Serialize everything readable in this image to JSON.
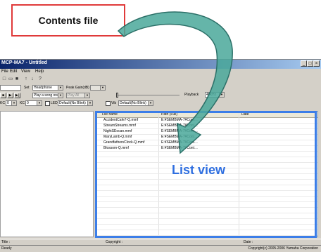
{
  "callout": {
    "text": "Contents file"
  },
  "list_view_label": "List view",
  "window": {
    "title": "MCP-MA7 - Untitled",
    "controls": [
      "_",
      "□",
      "×"
    ]
  },
  "menu": [
    "File",
    "Edit",
    "View",
    "Help"
  ],
  "toolbar": [
    "□",
    "▭",
    "■",
    "↑",
    "↓",
    "?"
  ],
  "row1": {
    "set_label": "Set",
    "set_value": "Headphone",
    "peak_label": "Peak Gain(dB)",
    "peak_value": ""
  },
  "row2": {
    "play_mode": "Play a song once",
    "play_mode2": "Play All"
  },
  "row3": {
    "c1_label": "KC",
    "c1_value": "0",
    "c2_label": "KC",
    "c2_value": "0",
    "led_label": "LED",
    "led_value": "Default(No Blink)",
    "vib_label": "Vib",
    "vib_value": "Default(No Blink)",
    "playback_label": "Playback",
    "playback_value": "40kHz"
  },
  "list": {
    "columns": [
      "File name",
      "Path (Full)",
      "Date"
    ],
    "rows": [
      {
        "name": "AccidentCafe7-Q.mmf",
        "path": "E:¥SEMBMA-7¥Cont…"
      },
      {
        "name": "StreamStreams.mmf",
        "path": "E:¥SEMBMA-7¥Cont…"
      },
      {
        "name": "NightSEocan.mmf",
        "path": "E:¥SEMBMA-7¥Cont…"
      },
      {
        "name": "MaryLamb-Q.mmf",
        "path": "E:¥SEMBMA-7¥Cont…"
      },
      {
        "name": "GrandfathersClock-Q.mmf",
        "path": "E:¥SEMBMA-7¥Cont…"
      },
      {
        "name": "Blossom-Q.mmf",
        "path": "E:¥SEMBMA-7¥Cont…"
      }
    ]
  },
  "info": {
    "title_label": "Title :",
    "copyright_label": "Copyright :",
    "date_label": "Date :"
  },
  "status": {
    "left": "Ready",
    "right": "Copyright(c) 2005-2006 Yamaha Corporation"
  },
  "colors": {
    "callout_border": "#e03a3a",
    "arrow": "#3a9a8a",
    "list_frame": "#3c7ee8"
  }
}
